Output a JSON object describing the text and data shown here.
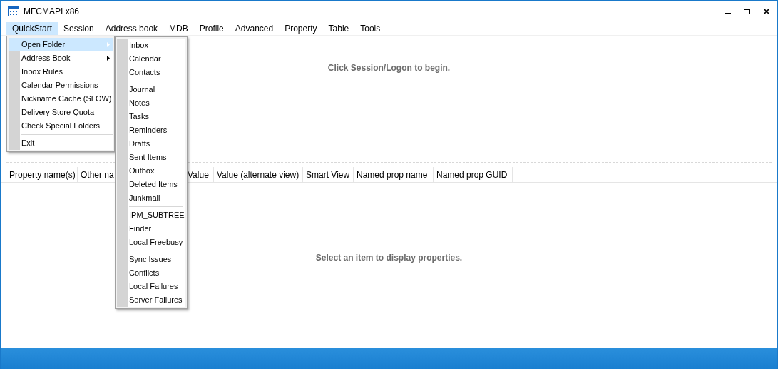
{
  "window": {
    "title": "MFCMAPI x86"
  },
  "menu_bar": [
    {
      "label": "QuickStart",
      "selected": true
    },
    {
      "label": "Session",
      "selected": false
    },
    {
      "label": "Address book",
      "selected": false
    },
    {
      "label": "MDB",
      "selected": false
    },
    {
      "label": "Profile",
      "selected": false
    },
    {
      "label": "Advanced",
      "selected": false
    },
    {
      "label": "Property",
      "selected": false
    },
    {
      "label": "Table",
      "selected": false
    },
    {
      "label": "Tools",
      "selected": false
    }
  ],
  "quickstart_menu": [
    {
      "kind": "item",
      "label": "Open Folder",
      "submenu": true,
      "selected": true
    },
    {
      "kind": "item",
      "label": "Address Book",
      "submenu": true,
      "selected": false
    },
    {
      "kind": "item",
      "label": "Inbox Rules",
      "submenu": false,
      "selected": false
    },
    {
      "kind": "item",
      "label": "Calendar Permissions",
      "submenu": false,
      "selected": false
    },
    {
      "kind": "item",
      "label": "Nickname Cache (SLOW)",
      "submenu": false,
      "selected": false
    },
    {
      "kind": "item",
      "label": "Delivery Store Quota",
      "submenu": false,
      "selected": false
    },
    {
      "kind": "item",
      "label": "Check Special Folders",
      "submenu": false,
      "selected": false
    },
    {
      "kind": "separator"
    },
    {
      "kind": "item",
      "label": "Exit",
      "submenu": false,
      "selected": false
    }
  ],
  "open_folder_submenu": [
    {
      "kind": "item",
      "label": "Inbox"
    },
    {
      "kind": "item",
      "label": "Calendar"
    },
    {
      "kind": "item",
      "label": "Contacts"
    },
    {
      "kind": "separator"
    },
    {
      "kind": "item",
      "label": "Journal"
    },
    {
      "kind": "item",
      "label": "Notes"
    },
    {
      "kind": "item",
      "label": "Tasks"
    },
    {
      "kind": "item",
      "label": "Reminders"
    },
    {
      "kind": "item",
      "label": "Drafts"
    },
    {
      "kind": "item",
      "label": "Sent Items"
    },
    {
      "kind": "item",
      "label": "Outbox"
    },
    {
      "kind": "item",
      "label": "Deleted Items"
    },
    {
      "kind": "item",
      "label": "Junkmail"
    },
    {
      "kind": "separator"
    },
    {
      "kind": "item",
      "label": "IPM_SUBTREE"
    },
    {
      "kind": "item",
      "label": "Finder"
    },
    {
      "kind": "item",
      "label": "Local Freebusy"
    },
    {
      "kind": "separator"
    },
    {
      "kind": "item",
      "label": "Sync Issues"
    },
    {
      "kind": "item",
      "label": "Conflicts"
    },
    {
      "kind": "item",
      "label": "Local Failures"
    },
    {
      "kind": "item",
      "label": "Server Failures"
    }
  ],
  "top_pane": {
    "message": "Click Session/Logon to begin."
  },
  "table": {
    "columns": [
      "Property name(s)",
      "Other na",
      "Value",
      "Value (alternate view)",
      "Smart View",
      "Named prop name",
      "Named prop GUID"
    ]
  },
  "bottom_pane": {
    "message": "Select an item to display properties."
  }
}
